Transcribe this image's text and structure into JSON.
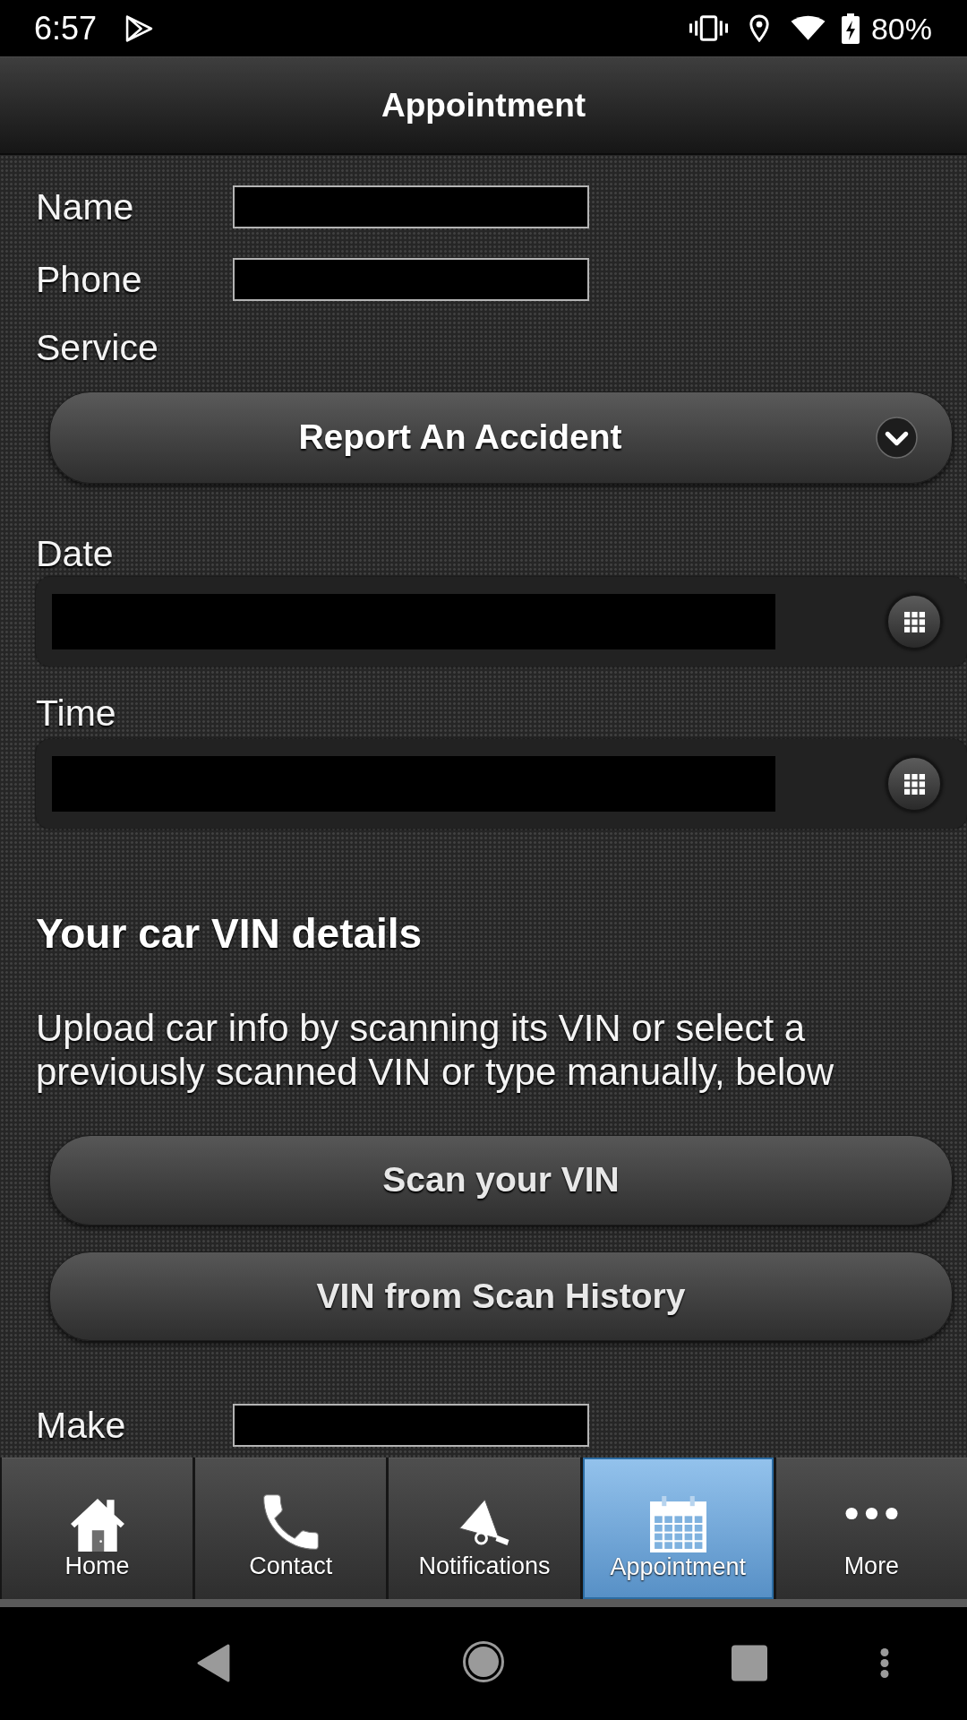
{
  "status_bar": {
    "time": "6:57",
    "battery": "80%"
  },
  "header": {
    "title": "Appointment"
  },
  "form": {
    "fields": [
      {
        "kind": "text",
        "label": "Name"
      },
      {
        "kind": "text",
        "label": "Phone"
      },
      {
        "kind": "select",
        "label": "Service",
        "value": "Report An Accident"
      },
      {
        "kind": "picker",
        "label": "Date"
      },
      {
        "kind": "picker",
        "label": "Time"
      }
    ]
  },
  "vin_section": {
    "heading": "Your car VIN details",
    "description": "Upload car info by scanning its VIN or select a previously scanned VIN or type manually, below",
    "buttons": [
      "Scan your VIN",
      "VIN from Scan History"
    ]
  },
  "vehicle_fields": [
    {
      "kind": "text",
      "label": "Make"
    }
  ],
  "tab_bar": [
    {
      "label": "Home",
      "selected": false
    },
    {
      "label": "Contact",
      "selected": false
    },
    {
      "label": "Notifications",
      "selected": false
    },
    {
      "label": "Appointment",
      "selected": true
    },
    {
      "label": "More",
      "selected": false
    }
  ]
}
